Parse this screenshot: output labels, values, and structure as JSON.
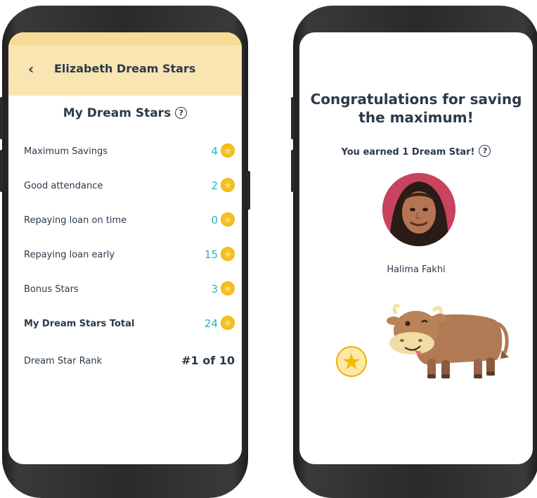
{
  "left_screen": {
    "back_icon": "chevron-left-icon",
    "back_glyph": "‹",
    "title": "Elizabeth Dream Stars",
    "section_title": "My Dream Stars",
    "help_glyph": "?",
    "star_glyph": "★",
    "rows": [
      {
        "label": "Maximum Savings",
        "value": "4"
      },
      {
        "label": "Good attendance",
        "value": "2"
      },
      {
        "label": "Repaying loan on time",
        "value": "0"
      },
      {
        "label": "Repaying loan early",
        "value": "15"
      },
      {
        "label": "Bonus Stars",
        "value": "3"
      }
    ],
    "total": {
      "label": "My Dream Stars Total",
      "value": "24"
    },
    "rank": {
      "label": "Dream Star Rank",
      "value": "#1 of 10"
    }
  },
  "right_screen": {
    "headline_line1": "Congratulations for saving",
    "headline_line2": "the maximum!",
    "earned_text": "You earned 1 Dream Star!",
    "help_glyph": "?",
    "member_name": "Halima Fakhi",
    "star_glyph": "★"
  },
  "colors": {
    "header_bg": "#f9e5b1",
    "value_teal": "#26b5b5",
    "star_gold": "#f5c01f",
    "text_dark": "#2b3a4a"
  }
}
